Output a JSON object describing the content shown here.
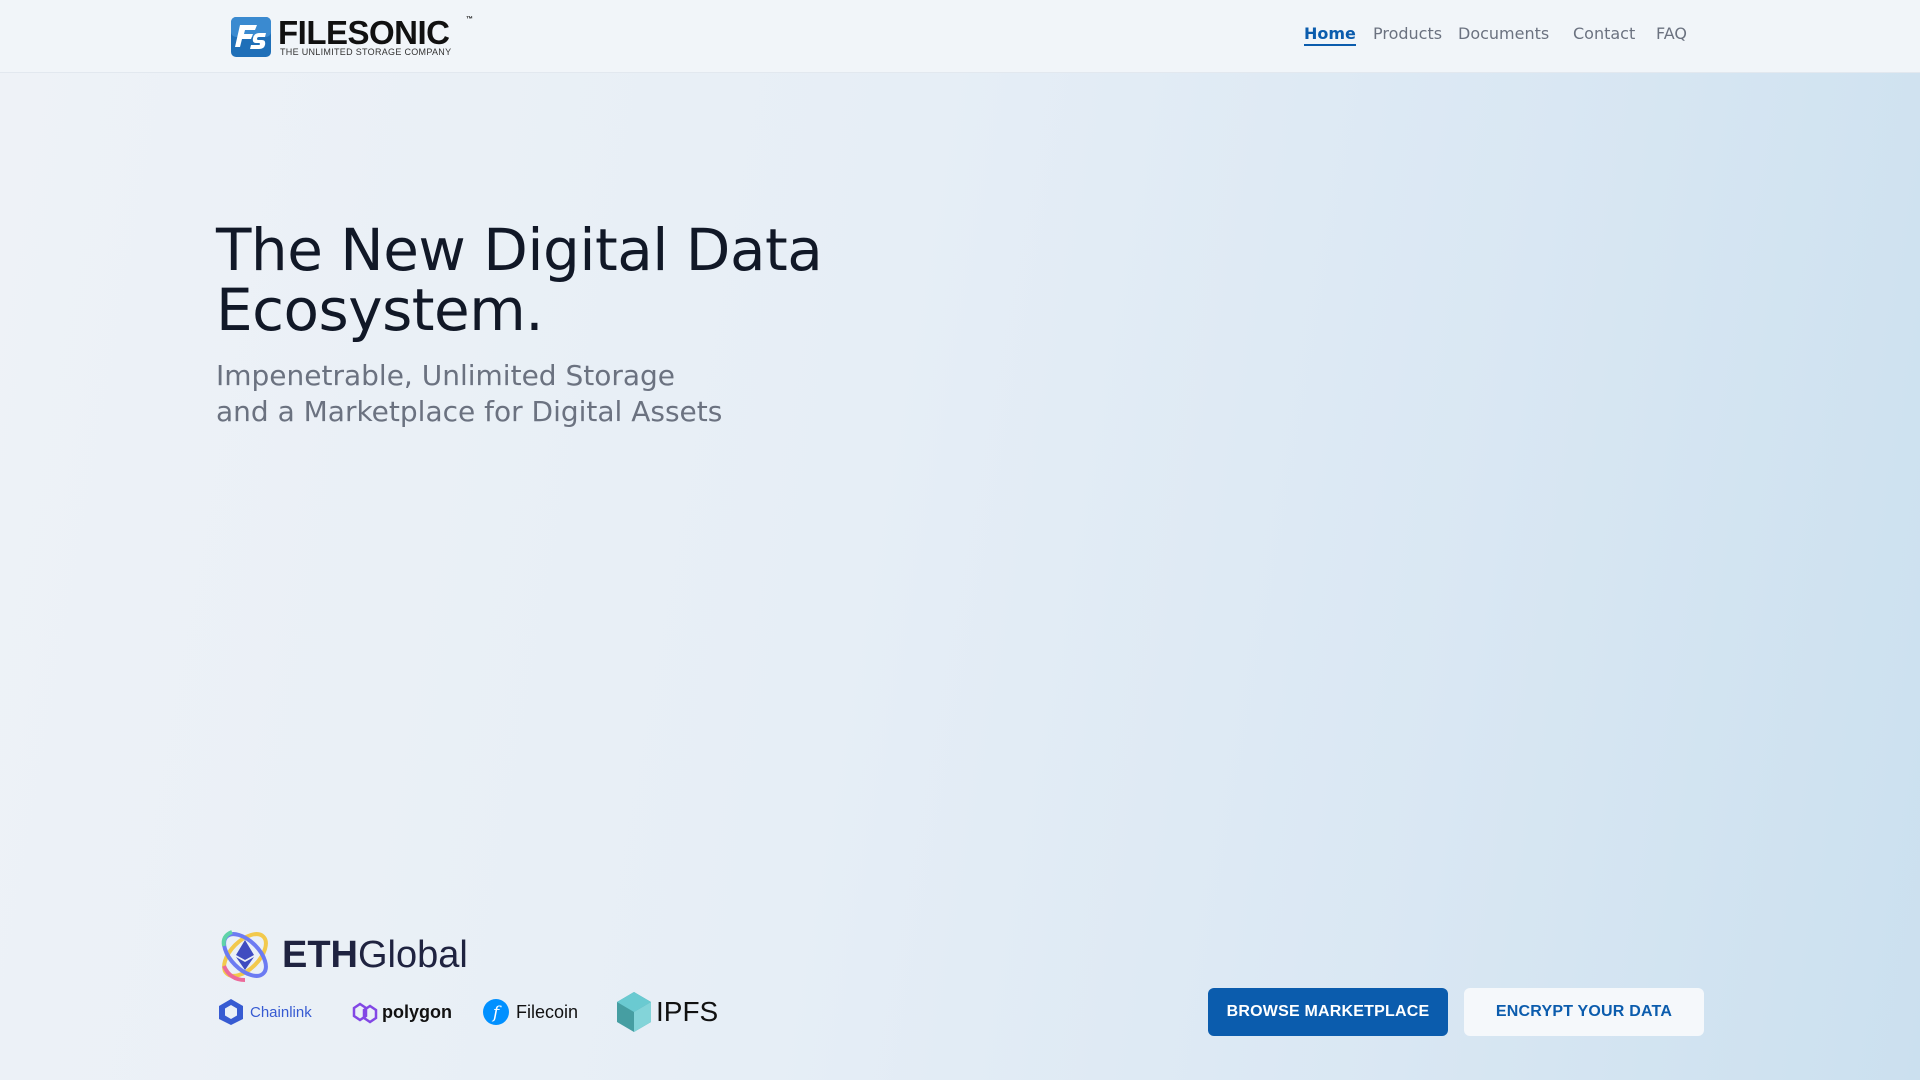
{
  "header": {
    "logo": {
      "name": "FILESONIC",
      "tm": "™",
      "tagline": "THE UNLIMITED STORAGE COMPANY"
    },
    "nav": [
      {
        "label": "Home",
        "active": true
      },
      {
        "label": "Products",
        "active": false
      },
      {
        "label": "Documents",
        "active": false
      },
      {
        "label": "Contact",
        "active": false
      },
      {
        "label": "FAQ",
        "active": false
      }
    ]
  },
  "hero": {
    "title_line1": "The New Digital Data",
    "title_line2": "Ecosystem.",
    "subtitle_line1": "Impenetrable, Unlimited Storage",
    "subtitle_line2": "and a Marketplace for Digital Assets"
  },
  "sponsors": {
    "main": {
      "bold": "ETH",
      "regular": "Global"
    },
    "partners": [
      {
        "name": "Chainlink",
        "icon": "chainlink-icon"
      },
      {
        "name": "polygon",
        "icon": "polygon-icon"
      },
      {
        "name": "Filecoin",
        "icon": "filecoin-icon"
      },
      {
        "name": "IPFS",
        "icon": "ipfs-icon"
      }
    ]
  },
  "actions": {
    "browse": "BROWSE MARKETPLACE",
    "encrypt": "ENCRYPT YOUR DATA"
  },
  "colors": {
    "accent": "#0b5cad",
    "title": "#111827",
    "muted": "#6b7280"
  }
}
